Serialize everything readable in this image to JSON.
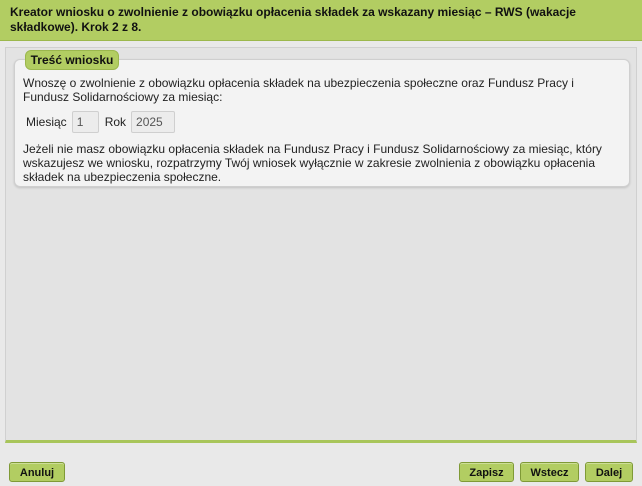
{
  "header": {
    "title": "Kreator wniosku o zwolnienie z obowiązku opłacenia składek za wskazany miesiąc – RWS (wakacje składkowe). Krok 2 z 8."
  },
  "section": {
    "legend": "Treść wniosku",
    "intro": "Wnoszę o zwolnienie z obowiązku opłacenia składek na ubezpieczenia społeczne oraz Fundusz Pracy i Fundusz Solidarnościowy za miesiąc:",
    "month_label": "Miesiąc",
    "month_value": "1",
    "year_label": "Rok",
    "year_value": "2025",
    "note": "Jeżeli nie masz obowiązku opłacenia składek na Fundusz Pracy i Fundusz Solidarnościowy za miesiąc, który wskazujesz we wniosku, rozpatrzymy Twój wniosek wyłącznie w zakresie zwolnienia z obowiązku opłacenia składek na ubezpieczenia społeczne."
  },
  "buttons": {
    "cancel": "Anuluj",
    "save": "Zapisz",
    "back": "Wstecz",
    "next": "Dalej"
  },
  "colors": {
    "accent": "#b2cd62",
    "background": "#e9e9e9"
  }
}
